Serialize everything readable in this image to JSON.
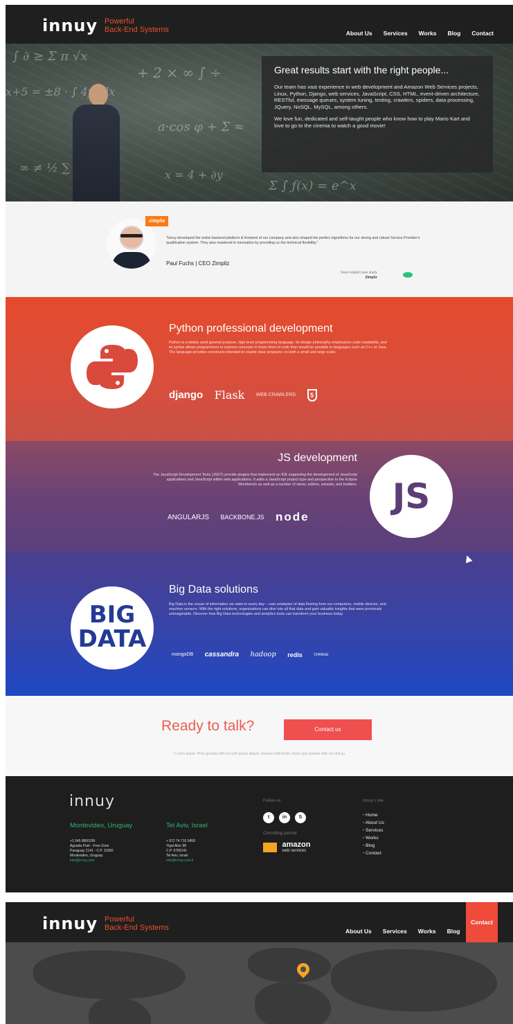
{
  "header": {
    "logo": "innuy",
    "tagline_line1": "Powerful",
    "tagline_line2": "Back-End Systems",
    "nav": [
      "About Us",
      "Services",
      "Works",
      "Blog",
      "Contact"
    ]
  },
  "hero": {
    "title": "Great results start with the right people...",
    "paragraph1": "Our team has vast experience in web development and Amazon Web Services projects, Linux, Python, Django, web services, JavaScript, CSS, HTML, event-driven architecture, RESTful, message queues, system tuning, testing, crawlers, spiders, data processing, JQuery, NoSQL, MySQL, among others.",
    "paragraph2": "We love fun, dedicated and self-taught people who know how to play Mario Kart and love to go to the cinema to watch a good movie!"
  },
  "testimonial": {
    "badge": "zimpliz",
    "quote": "\"Innuy developed the entire backend platform & frontend of our company and also shaped the perfect algorithms for our strong and robust Service Provider's qualification system. They also mastered in innovation by providing us the technical flexibility.\"",
    "author": "Paul Fuchs | CEO Zimpliz",
    "case_label": "View related case study",
    "case_name": "Zimpliz"
  },
  "sections": {
    "python": {
      "title": "Python professional development",
      "text": "Python is a widely used general-purpose, high-level programming language. Its design philosophy emphasizes code readability, and its syntax allows programmers to express concepts in fewer lines of code than would be possible in languages such as C++ or Java. The language provides constructs intended to enable clear programs on both a small and large scale.",
      "tech": [
        "django",
        "Flask",
        "WEB CRAWLERS"
      ]
    },
    "js": {
      "title": "JS development",
      "badge": "JS",
      "text": "The JavaScript Development Tools (JSDT) provide plugins that implement an IDE supporting the development of JavaScript applications and JavaScript within web applications. It adds a JavaScript project type and perspective to the Eclipse Workbench as well as a number of views, editors, wizards, and builders.",
      "tech": [
        "ANGULARJS",
        "BACKBONE.JS",
        "node"
      ]
    },
    "bigdata": {
      "title": "Big Data solutions",
      "badge_line1": "BIG",
      "badge_line2": "DATA",
      "text": "Big Data is the ocean of information we swim in every day – vast zetabytes of data flowing from our computers, mobile devices, and machine sensors. With the right solutions, organizations can dive into all that data and gain valuable insights that were previously unimaginable. Discover how Big Data technologies and analytics tools can transform your business today.",
      "tech": [
        "mongoDB",
        "cassandra",
        "hadoop",
        "redis",
        "CHANGE"
      ]
    }
  },
  "talk": {
    "title": "Ready to talk?",
    "button": "Contact us",
    "note": "* Lorem ipsum. Proin gravida nibh vel velit auctor aliquet. Aenean sollicitudin, lorem quis gravida nibh vel velit au."
  },
  "footer": {
    "logo": "innuy",
    "office1": {
      "city": "Montevideo, Uruguay",
      "phone": "+1 545 8800299",
      "line1": "Aguada Park - Free Zone",
      "line2": "Paraguay 2141 - C.P. 11800",
      "line3": "Montevideo, Uruguay",
      "email": "info@innuy.com"
    },
    "office2": {
      "city": "Tel Aviv, Israel",
      "phone": "+ 972 74 710 5458",
      "line1": "Yigal Alon 98",
      "line2": "C.P. 6789141",
      "line3": "Tel Aviv, Israel",
      "email": "info@innuy.com.il"
    },
    "follow_label": "Follow us",
    "partner_label": "Consulting partner",
    "partner_name": "amazon",
    "partner_sub": "web services",
    "site_label": "Innuy's site",
    "links": [
      "Home",
      "About Us",
      "Services",
      "Works",
      "Blog",
      "Contact"
    ]
  },
  "header2": {
    "logo": "innuy",
    "tagline_line1": "Powerful",
    "tagline_line2": "Back-End Systems",
    "nav": [
      "About Us",
      "Services",
      "Works",
      "Blog",
      "Contact"
    ],
    "active": "Contact"
  },
  "colors": {
    "accent_orange": "#e6502c",
    "green": "#2eb872",
    "contact_red": "#ef4f4f",
    "pin": "#f3a425"
  }
}
